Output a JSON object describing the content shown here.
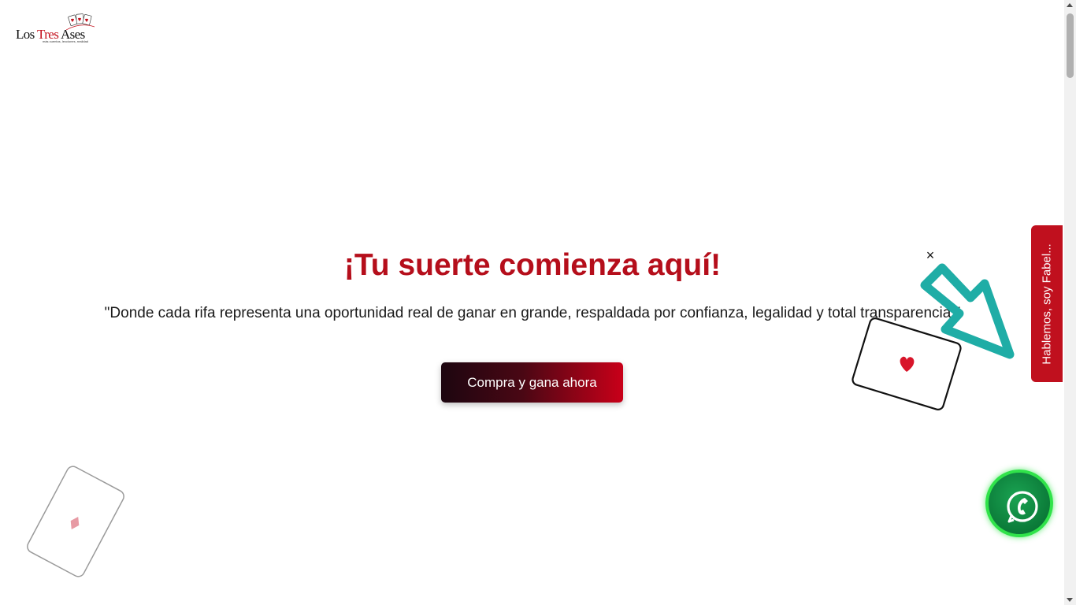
{
  "logo": {
    "brand_prefix": "Los ",
    "brand_tres": "Tres",
    "brand_suffix": " Ases",
    "tagline": "más cuentos, lecciones, realidad"
  },
  "hero": {
    "title": "¡Tu suerte comienza aquí!",
    "quote": "\"Donde cada rifa representa una oportunidad real de ganar en grande, respaldada por confianza, legalidad y total transparencia.\"",
    "cta_label": "Compra y gana ahora"
  },
  "popup": {
    "close_label": "×"
  },
  "side_tab": {
    "label": "Hablemos, soy Fabel..."
  },
  "chat": {
    "icon": "whatsapp-phone-icon"
  },
  "colors": {
    "brand_red": "#b50e1b",
    "tab_red": "#c0101e",
    "whatsapp_green": "#0b7a38",
    "arrow_teal": "#1fada6"
  }
}
